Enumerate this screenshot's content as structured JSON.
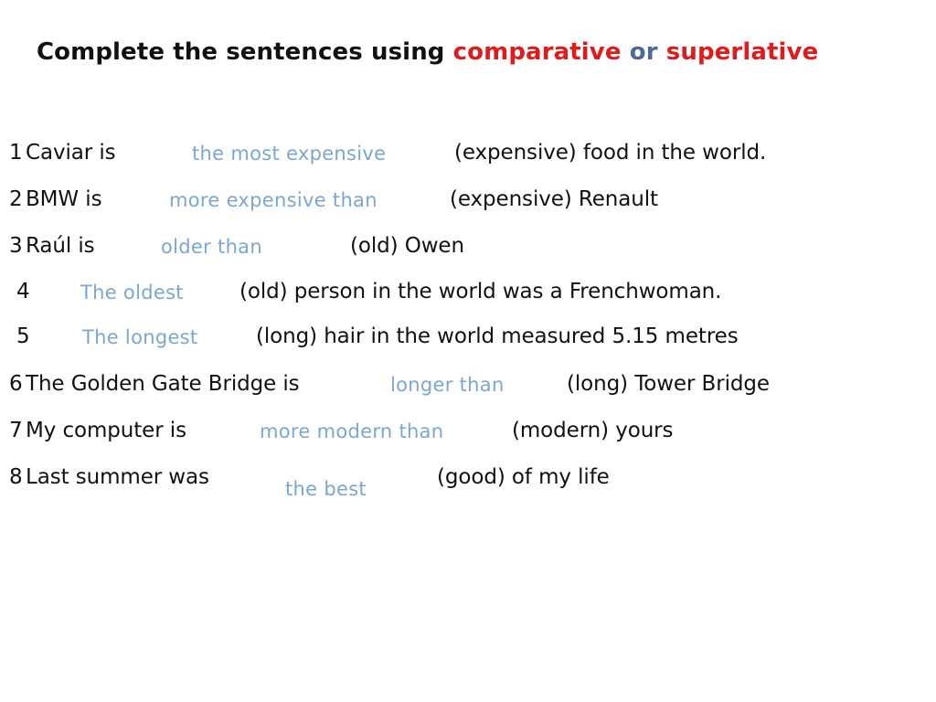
{
  "page": {
    "background_color": "#ffffff",
    "kind": "english-grammar-worksheet-slide"
  },
  "title": {
    "part1": "Complete the sentences using ",
    "comparative": "comparative",
    "conjunction": " or ",
    "superlative": "superlative",
    "full_text": "Complete the sentences using comparative or superlative",
    "color_plain": "#111111",
    "color_red": "#e01b1b",
    "color_blue": "#4a6a9a"
  },
  "answer_color": "#7ba7d0",
  "exercises": [
    {
      "number": "1",
      "prompt_before": "Caviar is",
      "answer": "the most expensive",
      "prompt_after": "(expensive) food in the world.",
      "cue": "expensive",
      "form": "superlative"
    },
    {
      "number": "2",
      "prompt_before": "BMW is",
      "answer": "more expensive than",
      "prompt_after": "(expensive) Renault",
      "cue": "expensive",
      "form": "comparative"
    },
    {
      "number": "3",
      "prompt_before": "Raúl is",
      "answer": "older than",
      "prompt_after": "(old) Owen",
      "cue": "old",
      "form": "comparative"
    },
    {
      "number": "4",
      "prompt_before": "",
      "answer": "The oldest",
      "prompt_after": "(old) person in the world was a Frenchwoman.",
      "cue": "old",
      "form": "superlative"
    },
    {
      "number": "5",
      "prompt_before": "",
      "answer": "The longest",
      "prompt_after": "(long) hair in the world measured 5.15 metres",
      "cue": "long",
      "form": "superlative"
    },
    {
      "number": "6",
      "prompt_before": "The Golden Gate Bridge is",
      "answer": "longer than",
      "prompt_after": "(long) Tower Bridge",
      "cue": "long",
      "form": "comparative"
    },
    {
      "number": "7",
      "prompt_before": "My computer is",
      "answer": "more modern than",
      "prompt_after": "(modern) yours",
      "cue": "modern",
      "form": "comparative"
    },
    {
      "number": "8",
      "prompt_before": "Last summer was",
      "answer": "the best",
      "prompt_after": "(good) of my life",
      "cue": "good",
      "form": "superlative"
    }
  ]
}
